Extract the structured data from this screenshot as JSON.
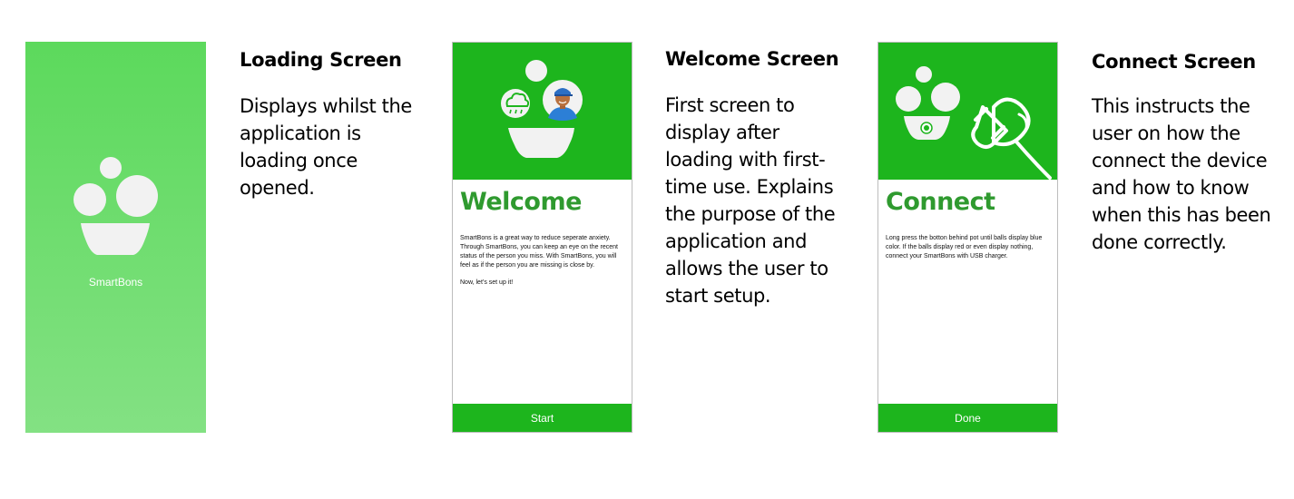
{
  "loading": {
    "app_name": "SmartBons",
    "logo_icon": "bowl-bubbles-logo"
  },
  "welcome": {
    "heading": "Welcome",
    "body": [
      "SmartBons is a great way to reduce seperate anxiety. Through SmartBons, you can keep an eye on the recent status of the person you miss. With SmartBons, you will feel as if the person you are missing is close by.",
      "Now, let’s set up it!"
    ],
    "button_label": "Start",
    "hero_icons": [
      "weather-rain-cloud-icon",
      "person-avatar-icon",
      "bowl-icon"
    ]
  },
  "connect": {
    "heading": "Connect",
    "body": [
      "Long press the botton behind pot until balls display blue color. If the balls display red or even display nothing, connect your SmartBons with USB charger."
    ],
    "button_label": "Done",
    "hero_icons": [
      "bowl-bubbles-icon",
      "power-plug-icon"
    ]
  },
  "descriptions": {
    "loading": {
      "title": "Loading Screen",
      "text": "Displays whilst the application is loading once opened."
    },
    "welcome": {
      "title": "Welcome Screen",
      "text": "First screen to display after loading with first-time use. Explains the purpose of the application and allows the user to start setup."
    },
    "connect": {
      "title": "Connect Screen",
      "text": "This instructs the user on how the connect the device and how to know when this has been done correctly."
    }
  },
  "colors": {
    "primary_green": "#1db51d",
    "heading_green": "#2f9a2f",
    "loading_gradient_top": "#5cd95c",
    "loading_gradient_bottom": "#83e183",
    "shape_light": "#f2f2f2"
  }
}
